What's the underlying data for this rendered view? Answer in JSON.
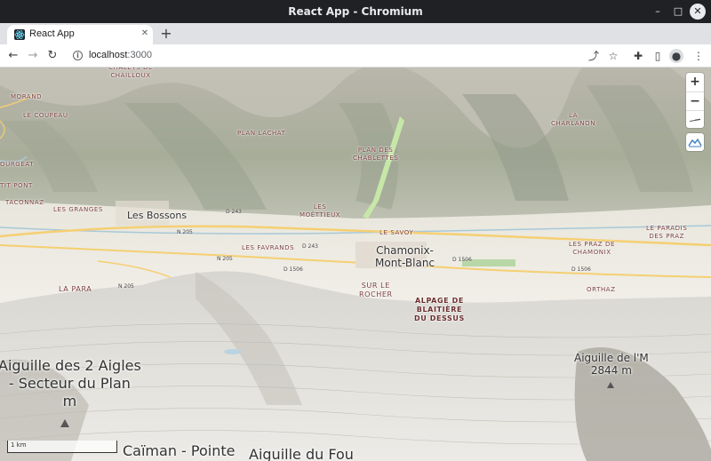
{
  "window": {
    "title": "React App - Chromium",
    "min": "–",
    "max": "□",
    "close": "✕"
  },
  "tab": {
    "title": "React App",
    "close": "✕",
    "new_tab": "+"
  },
  "toolbar": {
    "back": "←",
    "forward": "→",
    "reload": "↻",
    "url_host": "localhost",
    "url_port": ":3000",
    "info": "i"
  },
  "toolbar_icons": {
    "share": "⤴",
    "star": "☆",
    "extensions": "✚",
    "sidepanel": "▯",
    "profile": "●",
    "menu": "⋮"
  },
  "map": {
    "controls": {
      "zoom_in": "+",
      "zoom_out": "−",
      "compass": "▲"
    },
    "scale": "1 km",
    "places": [
      {
        "text": "CHALETS DE\nCHAILLOUX",
        "cls": "lbl"
      },
      {
        "text": "MORAND",
        "cls": "lbl"
      },
      {
        "text": "LE COUPEAU",
        "cls": "lbl"
      },
      {
        "text": "PLAN LACHAT",
        "cls": "lbl"
      },
      {
        "text": "PLAN DES\nCHABLETTES",
        "cls": "lbl"
      },
      {
        "text": "LA\nCHARLANON",
        "cls": "lbl"
      },
      {
        "text": "OURGEAT",
        "cls": "lbl"
      },
      {
        "text": "TIT PONT",
        "cls": "lbl"
      },
      {
        "text": "TACONNAZ",
        "cls": "lbl"
      },
      {
        "text": "LES GRANGES",
        "cls": "lbl"
      },
      {
        "text": "LES\nMOËTTIEUX",
        "cls": "lbl"
      },
      {
        "text": "LE SAVOY",
        "cls": "lbl"
      },
      {
        "text": "LE PARADIS\nDES PRAZ",
        "cls": "lbl"
      },
      {
        "text": "LES FAVRANDS",
        "cls": "lbl"
      },
      {
        "text": "LES PRAZ DE\nCHAMONIX",
        "cls": "lbl"
      },
      {
        "text": "LA PARA",
        "cls": "lbl"
      },
      {
        "text": "SUR LE\nROCHER",
        "cls": "lbl"
      },
      {
        "text": "ORTHAZ",
        "cls": "lbl"
      },
      {
        "text": "ALPAGE DE\nBLAITIÈRE\nDU DESSUS",
        "cls": "lbl bold"
      }
    ],
    "cities": [
      {
        "text": "Les Bossons"
      },
      {
        "text": "Chamonix-\nMont-Blanc"
      }
    ],
    "roads": [
      "D 243",
      "N 205",
      "D 243",
      "N 205",
      "D 1506",
      "D 1506",
      "D 1506",
      "N 205"
    ],
    "peaks": [
      {
        "text": "Aiguille des 2 Aigles\n- Secteur du Plan\nm"
      },
      {
        "text": "Aiguille de l'M\n2844 m"
      },
      {
        "text": "Caïman - Pointe"
      },
      {
        "text": "Aiguille du Fou"
      }
    ]
  }
}
